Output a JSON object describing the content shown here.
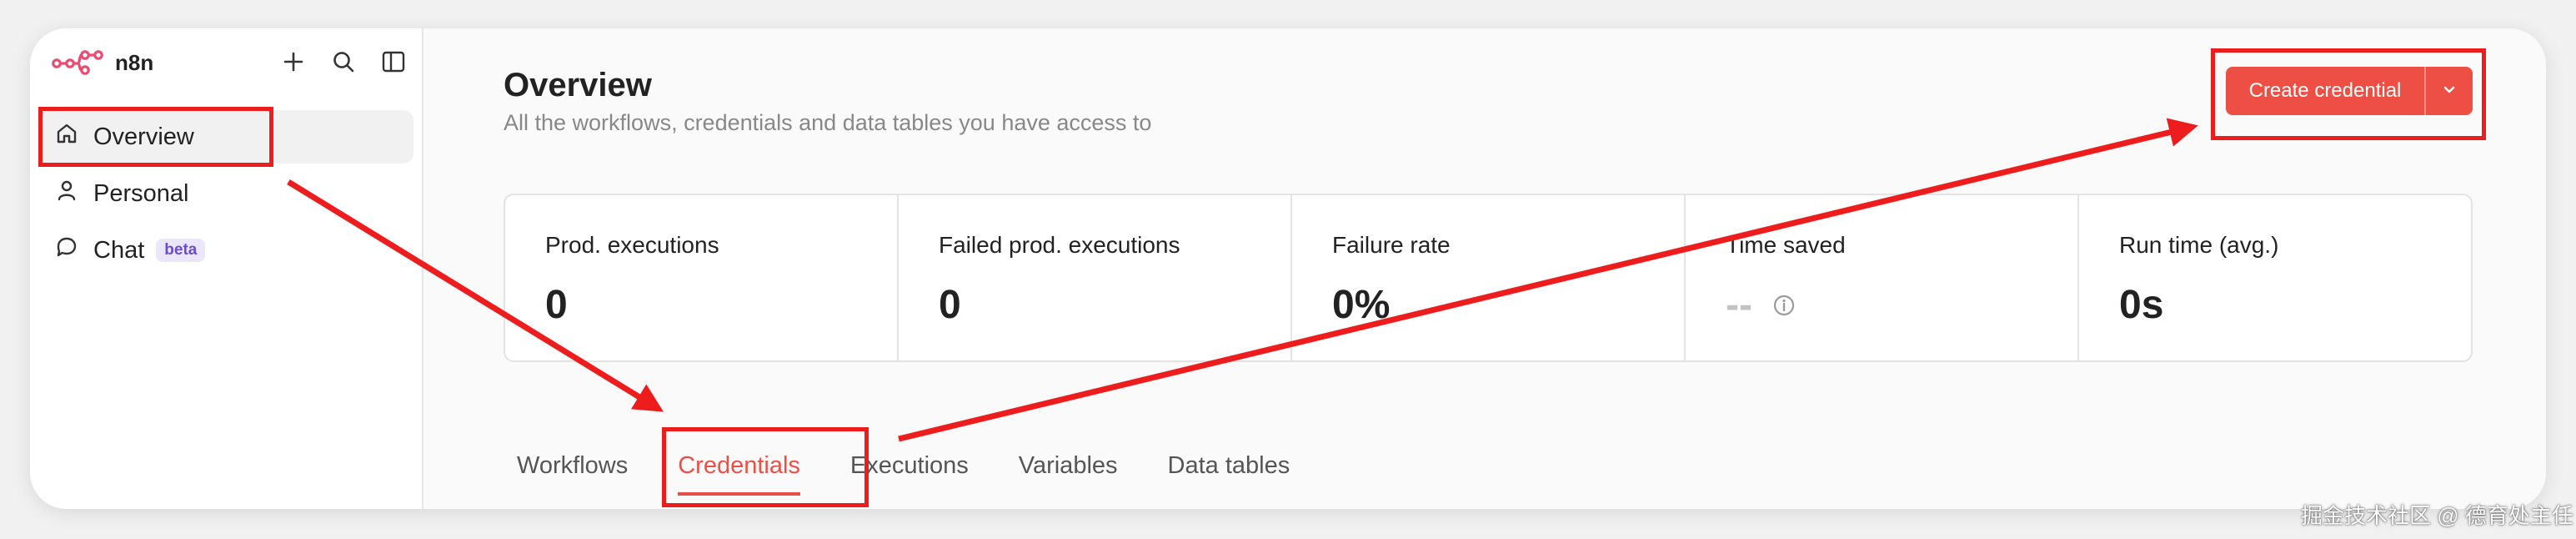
{
  "app": {
    "name": "n8n"
  },
  "sidebar": {
    "items": [
      {
        "label": "Overview",
        "icon": "home-icon",
        "active": true
      },
      {
        "label": "Personal",
        "icon": "user-icon"
      },
      {
        "label": "Chat",
        "icon": "chat-icon",
        "badge": "beta"
      }
    ]
  },
  "header": {
    "title": "Overview",
    "subtitle": "All the workflows, credentials and data tables you have access to",
    "create_button": "Create credential"
  },
  "stats": [
    {
      "label": "Prod. executions",
      "value": "0"
    },
    {
      "label": "Failed prod. executions",
      "value": "0"
    },
    {
      "label": "Failure rate",
      "value": "0%"
    },
    {
      "label": "Time saved",
      "value": "--"
    },
    {
      "label": "Run time (avg.)",
      "value": "0s"
    }
  ],
  "tabs": [
    {
      "label": "Workflows"
    },
    {
      "label": "Credentials",
      "active": true
    },
    {
      "label": "Executions"
    },
    {
      "label": "Variables"
    },
    {
      "label": "Data tables"
    }
  ],
  "watermark": "掘金技术社区 @ 德育处主任",
  "colors": {
    "accent": "#ee4f45",
    "annotation": "#ee1d1d",
    "badge_text": "#6a4bd8",
    "badge_bg": "#ebe6fb"
  }
}
